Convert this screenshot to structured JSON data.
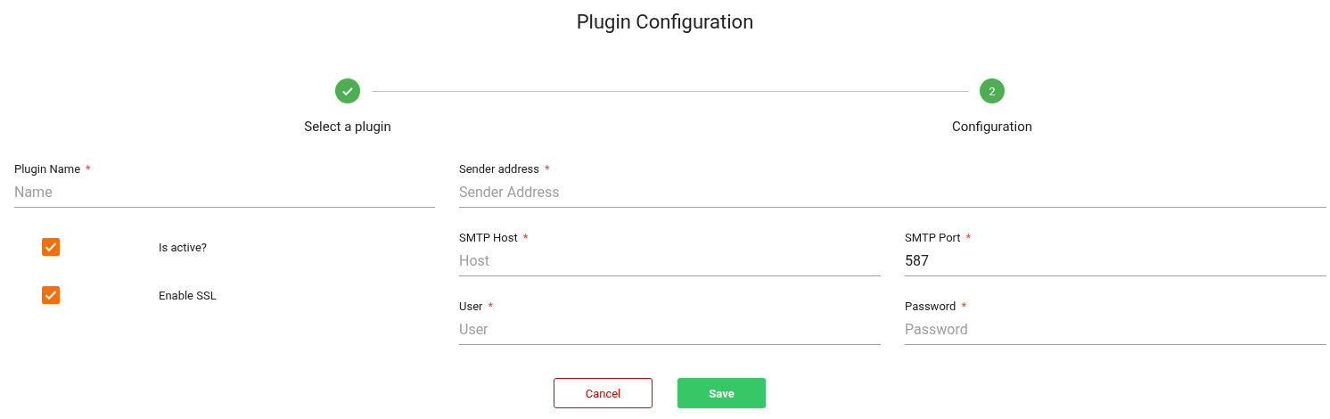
{
  "title": "Plugin Configuration",
  "steps": [
    {
      "label": "Select a plugin",
      "kind": "done"
    },
    {
      "label": "Configuration",
      "kind": "current",
      "number": "2"
    }
  ],
  "plugin_name": {
    "label": "Plugin Name",
    "required_mark": "*",
    "placeholder": "Name"
  },
  "checkboxes": [
    {
      "label": "Is active?",
      "checked": true
    },
    {
      "label": "Enable SSL",
      "checked": true
    }
  ],
  "sender": {
    "label": "Sender address",
    "required_mark": "*",
    "placeholder": "Sender Address"
  },
  "field_rows": [
    [
      {
        "label": "SMTP Host",
        "required_mark": "*",
        "placeholder": "Host"
      },
      {
        "label": "SMTP Port",
        "required_mark": "*",
        "value": "587"
      }
    ],
    [
      {
        "label": "User",
        "required_mark": "*",
        "placeholder": "User"
      },
      {
        "label": "Password",
        "required_mark": "*",
        "placeholder": "Password"
      }
    ]
  ],
  "buttons": [
    {
      "label": "Cancel",
      "kind": "secondary"
    },
    {
      "label": "Save",
      "kind": "primary"
    }
  ]
}
